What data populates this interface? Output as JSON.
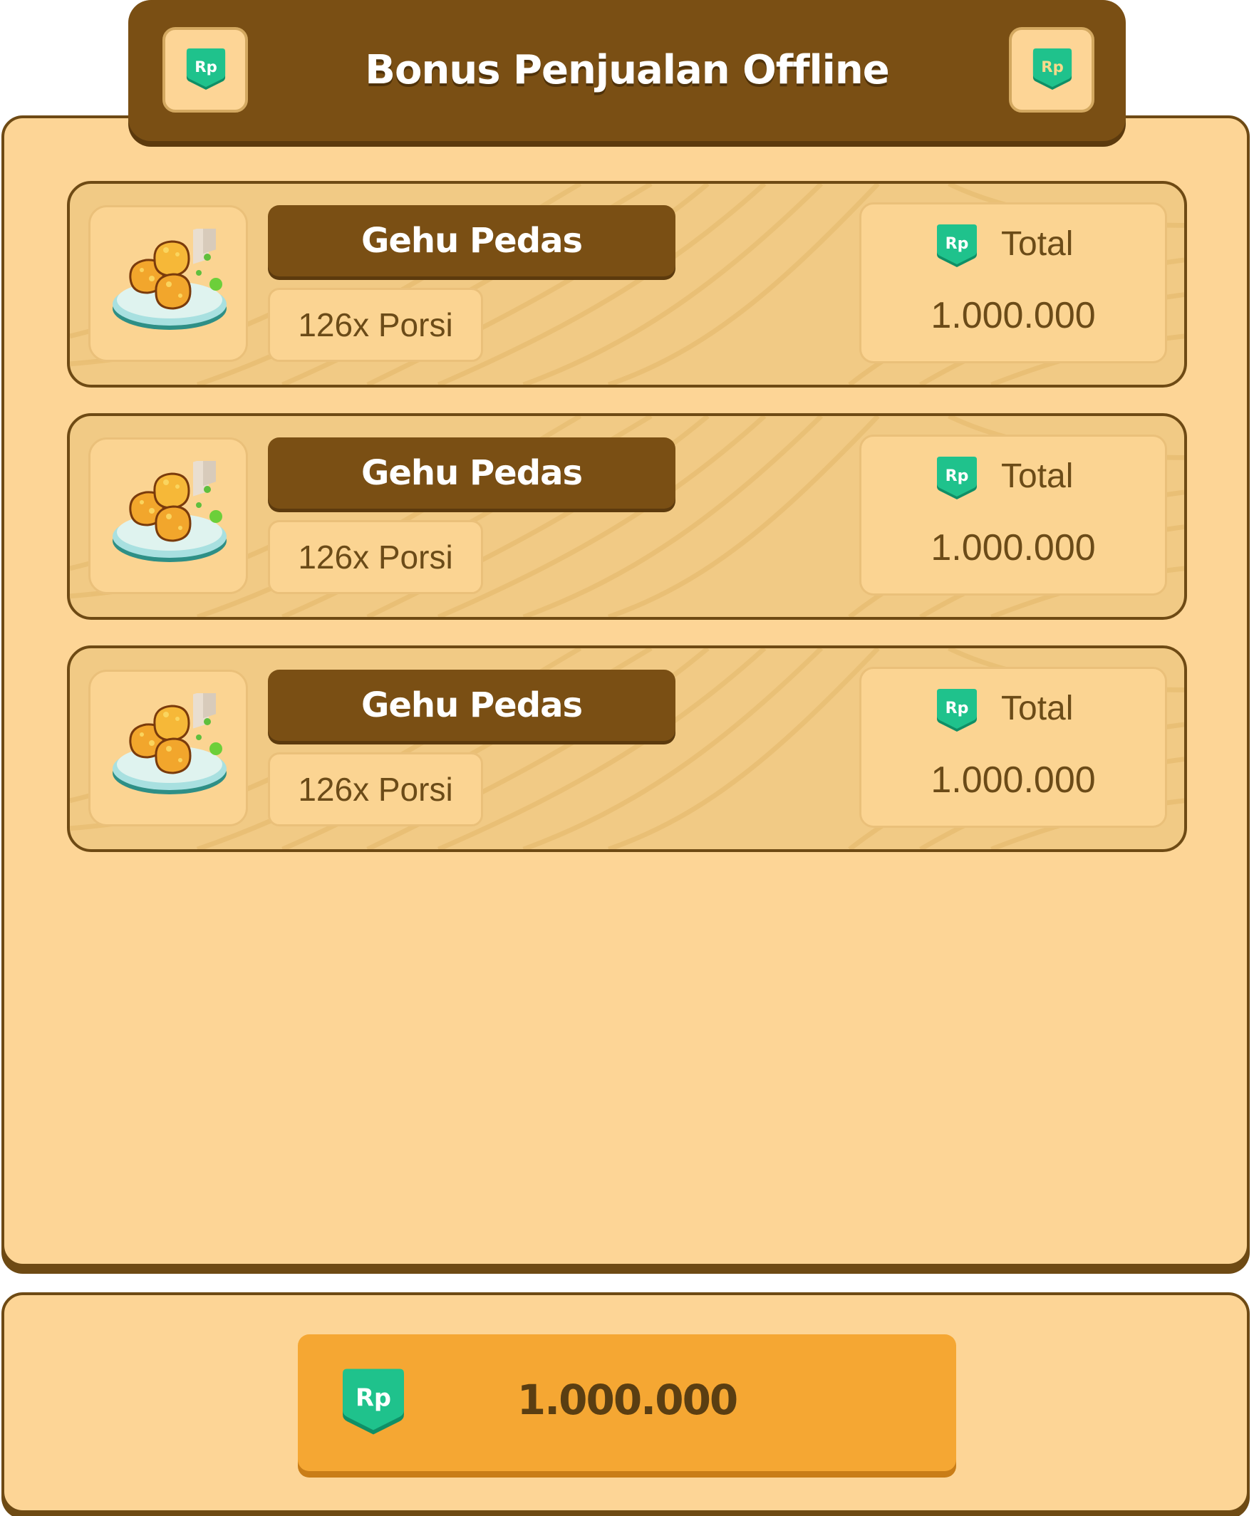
{
  "header": {
    "title": "Bonus Penjualan Offline",
    "left_icon": "rp-coin-icon",
    "right_icon": "rp-coin-icon"
  },
  "currency": {
    "symbol": "Rp"
  },
  "items": [
    {
      "name": "Gehu Pedas",
      "quantity": "126x Porsi",
      "total_label": "Total",
      "total_value": "1.000.000",
      "icon": "gehu-pedas-food-icon"
    },
    {
      "name": "Gehu Pedas",
      "quantity": "126x Porsi",
      "total_label": "Total",
      "total_value": "1.000.000",
      "icon": "gehu-pedas-food-icon"
    },
    {
      "name": "Gehu Pedas",
      "quantity": "126x Porsi",
      "total_label": "Total",
      "total_value": "1.000.000",
      "icon": "gehu-pedas-food-icon"
    }
  ],
  "footer": {
    "collect_value": "1.000.000"
  },
  "colors": {
    "panel": "#fdd596",
    "header": "#7a4f14",
    "button": "#f5a733",
    "coin": "#1fc28c",
    "text_dark": "#6b4b18"
  }
}
